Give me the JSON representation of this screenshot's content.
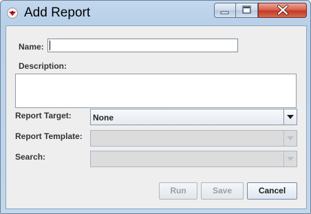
{
  "window": {
    "title": "Add Report",
    "colors": {
      "close_button": "#c84530",
      "frame": "#b9d0e9"
    }
  },
  "form": {
    "name_label": "Name:",
    "name_value": "",
    "description_label": "Description:",
    "description_value": "",
    "report_target_label": "Report Target:",
    "report_target_value": "None",
    "report_template_label": "Report Template:",
    "report_template_value": "",
    "search_label": "Search:",
    "search_value": ""
  },
  "buttons": {
    "run": "Run",
    "save": "Save",
    "cancel": "Cancel"
  }
}
